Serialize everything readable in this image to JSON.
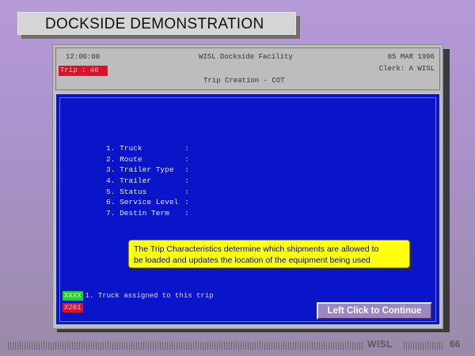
{
  "slide_title": "DOCKSIDE DEMONSTRATION",
  "header": {
    "time": "12:00:00",
    "facility": "WISL Dockside Facility",
    "date": "05 MAR 1996",
    "trip": "Trip : 46",
    "clerk": "Clerk: A WISL",
    "screen_name": "Trip Creation - COT"
  },
  "menu": {
    "items": [
      {
        "num": "1.",
        "label": "Truck",
        "sep": ":"
      },
      {
        "num": "2.",
        "label": "Route",
        "sep": ":"
      },
      {
        "num": "3.",
        "label": "Trailer Type",
        "sep": ":"
      },
      {
        "num": "4.",
        "label": "Trailer",
        "sep": ":"
      },
      {
        "num": "5.",
        "label": "Status",
        "sep": ":"
      },
      {
        "num": "6.",
        "label": "Service Level",
        "sep": ":"
      },
      {
        "num": "7.",
        "label": "Destin Term",
        "sep": ":"
      }
    ]
  },
  "callout": {
    "line1": "The Trip Characteristics determine which shipments are allowed to",
    "line2": "be loaded and updates the location of the equipment being used"
  },
  "status": {
    "green_tag": "XXXX",
    "help_text": "1. Truck assigned to this trip",
    "red_tag": "X201"
  },
  "continue_button": "Left Click to Continue",
  "footer": {
    "brand": "WISL",
    "page": "66"
  },
  "colors": {
    "screen_blue": "#0a14c8",
    "callout_yellow": "#ffff10",
    "alert_red": "#e0102a",
    "tag_green": "#18d818"
  }
}
